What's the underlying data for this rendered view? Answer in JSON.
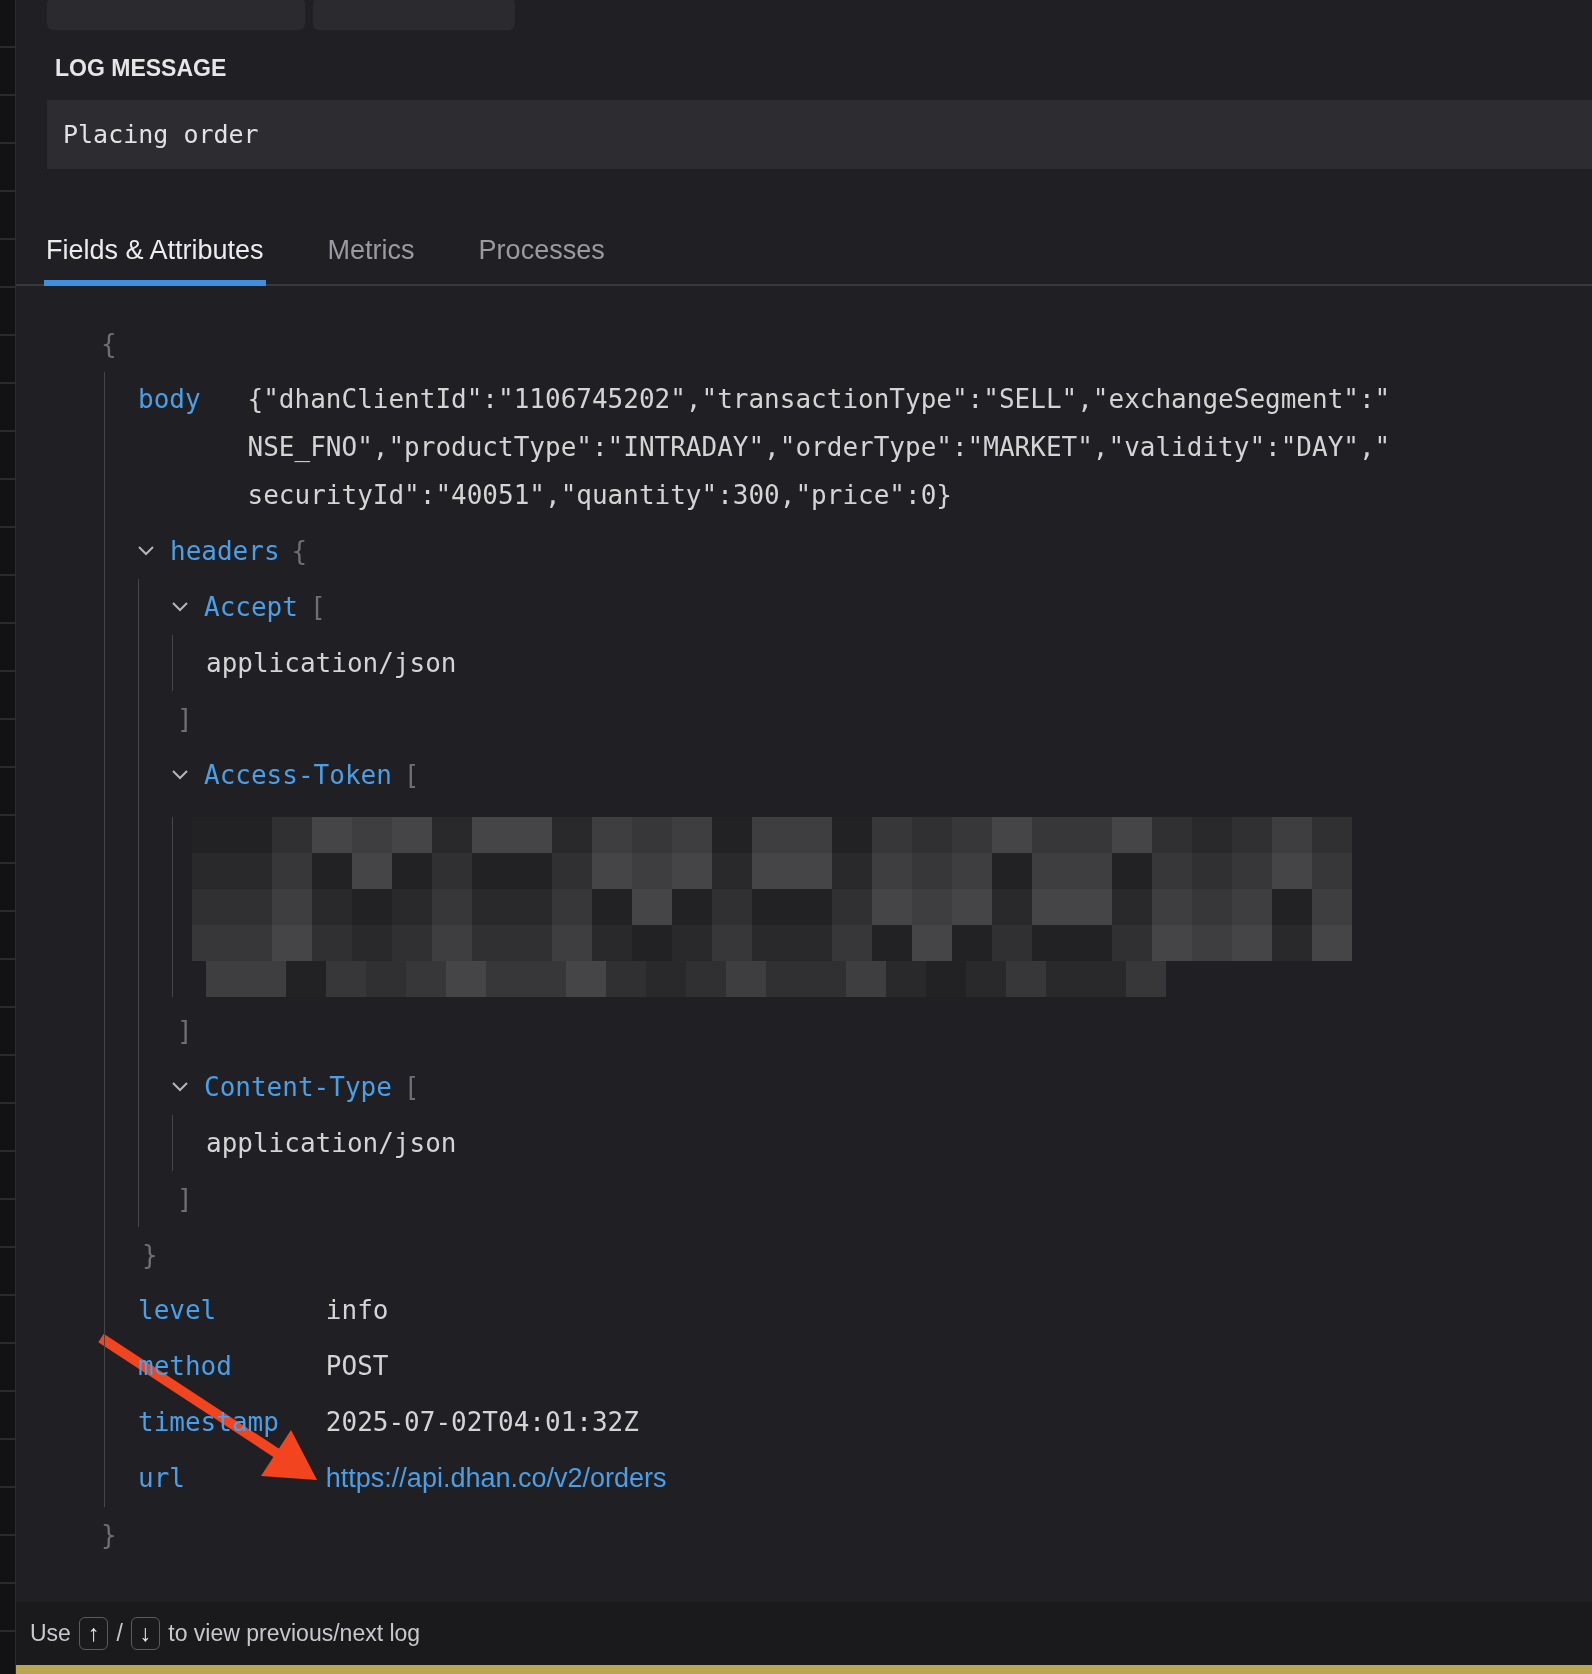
{
  "log_message": {
    "heading": "LOG MESSAGE",
    "text": "Placing order"
  },
  "tabs": [
    {
      "label": "Fields & Attributes",
      "selected": true
    },
    {
      "label": "Metrics",
      "selected": false
    },
    {
      "label": "Processes",
      "selected": false
    }
  ],
  "document": {
    "open": "{",
    "close": "}",
    "children": [
      {
        "kind": "text",
        "key": "body",
        "value": "{\"dhanClientId\":\"1106745202\",\"transactionType\":\"SELL\",\"exchangeSegment\":\"NSE_FNO\",\"productType\":\"INTRADAY\",\"orderType\":\"MARKET\",\"validity\":\"DAY\",\"securityId\":\"40051\",\"quantity\":300,\"price\":0}"
      },
      {
        "kind": "object",
        "key": "headers",
        "expanded": true,
        "open": "{",
        "close": "}",
        "children": [
          {
            "kind": "array",
            "key": "Accept",
            "expanded": true,
            "open": "[",
            "close": "]",
            "children": [
              {
                "kind": "text",
                "value": "application/json"
              }
            ]
          },
          {
            "kind": "array",
            "key": "Access-Token",
            "expanded": true,
            "open": "[",
            "close": "]",
            "children": [
              {
                "kind": "redacted"
              }
            ]
          },
          {
            "kind": "array",
            "key": "Content-Type",
            "expanded": true,
            "open": "[",
            "close": "]",
            "children": [
              {
                "kind": "text",
                "value": "application/json"
              }
            ]
          }
        ]
      },
      {
        "kind": "text",
        "key": "level",
        "value": "info"
      },
      {
        "kind": "text",
        "key": "method",
        "value": "POST"
      },
      {
        "kind": "text",
        "key": "timestamp",
        "value": "2025-07-02T04:01:32Z"
      },
      {
        "kind": "link",
        "key": "url",
        "value": "https://api.dhan.co/v2/orders"
      }
    ]
  },
  "footer": [
    {
      "kind": "text",
      "text": "Use"
    },
    {
      "kind": "key",
      "text": "↑"
    },
    {
      "kind": "text",
      "text": "/"
    },
    {
      "kind": "key",
      "text": "↓"
    },
    {
      "kind": "text",
      "text": "to view previous/next log"
    }
  ]
}
